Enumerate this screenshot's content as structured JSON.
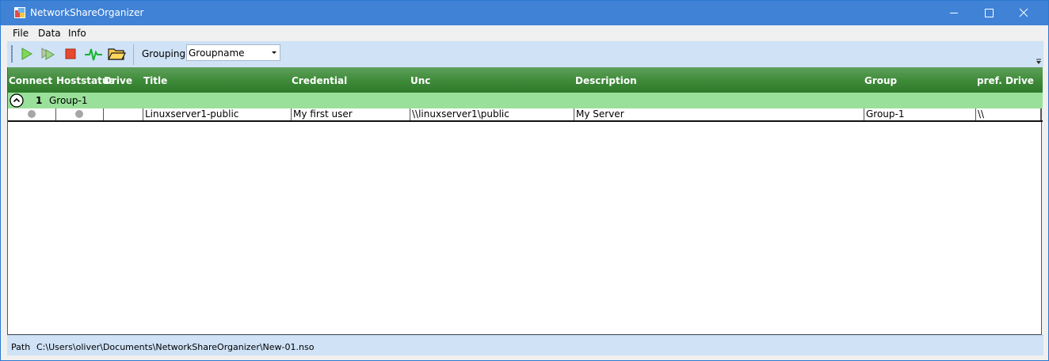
{
  "window": {
    "title": "NetworkShareOrganizer",
    "controls": {
      "minimize": "minimize",
      "maximize": "maximize",
      "close": "close"
    },
    "accent": "#3f82d6"
  },
  "menu": {
    "items": [
      "File",
      "Data",
      "Info"
    ]
  },
  "toolbar": {
    "buttons": [
      "play-icon",
      "play-all-icon",
      "stop-icon",
      "heartbeat-icon",
      "folder-open-icon"
    ],
    "grouping_label": "Grouping",
    "grouping_value": "Groupname"
  },
  "grid": {
    "header_color": "#3d8a38",
    "group_color": "#99e09a",
    "columns": [
      "Connect",
      "Hoststatus",
      "Drive",
      "Title",
      "Credential",
      "Unc",
      "Description",
      "Group",
      "pref. Drive"
    ],
    "groups": [
      {
        "count": "1",
        "name": "Group-1",
        "rows": [
          {
            "connect": "disconnected",
            "hoststatus": "unknown",
            "drive": "",
            "title": "Linuxserver1-public",
            "credential": "My first user",
            "unc": "\\\\linuxserver1\\public",
            "description": "My Server",
            "group": "Group-1",
            "pref_drive": "\\\\"
          }
        ]
      }
    ]
  },
  "status": {
    "label": "Path",
    "path": "C:\\Users\\oliver\\Documents\\NetworkShareOrganizer\\New-01.nso"
  }
}
